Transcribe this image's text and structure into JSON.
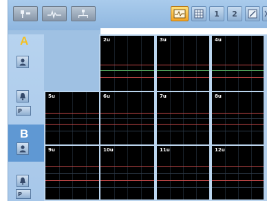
{
  "toolbar": {
    "buttons": [
      {
        "name": "tool-1",
        "icon": "probe-icon",
        "style": "gray"
      },
      {
        "name": "tool-2",
        "icon": "waveform-icon",
        "style": "gray"
      },
      {
        "name": "tool-3",
        "icon": "network-icon",
        "style": "gray"
      },
      {
        "name": "view-waveform",
        "icon": "waveform-view-icon",
        "style": "active"
      },
      {
        "name": "view-grid",
        "icon": "grid-view-icon",
        "style": "normal"
      },
      {
        "name": "view-1",
        "label": "1",
        "style": "normal"
      },
      {
        "name": "view-2",
        "label": "2",
        "style": "normal"
      },
      {
        "name": "view-edit",
        "icon": "edit-icon",
        "style": "normal"
      }
    ]
  },
  "sections": {
    "a": {
      "letter": "A"
    },
    "b": {
      "letter": "B"
    }
  },
  "buttons": {
    "person_a": "person-icon",
    "bell_a": "bell-icon",
    "p_a": "P",
    "person_b": "person-icon",
    "bell_b": "bell-icon",
    "p_b": "P"
  },
  "cells": [
    {
      "label": "2u"
    },
    {
      "label": "3u"
    },
    {
      "label": "4u"
    },
    {
      "label": "5u"
    },
    {
      "label": "6u"
    },
    {
      "label": "7u"
    },
    {
      "label": "8u"
    },
    {
      "label": "9u"
    },
    {
      "label": "10u"
    },
    {
      "label": "11u"
    },
    {
      "label": "12u"
    }
  ],
  "colors": {
    "accent_yellow": "#f4c021",
    "panel_blue": "#9fc1e3",
    "trace_red": "#c94a4a",
    "trace_green": "#4d9d57"
  }
}
